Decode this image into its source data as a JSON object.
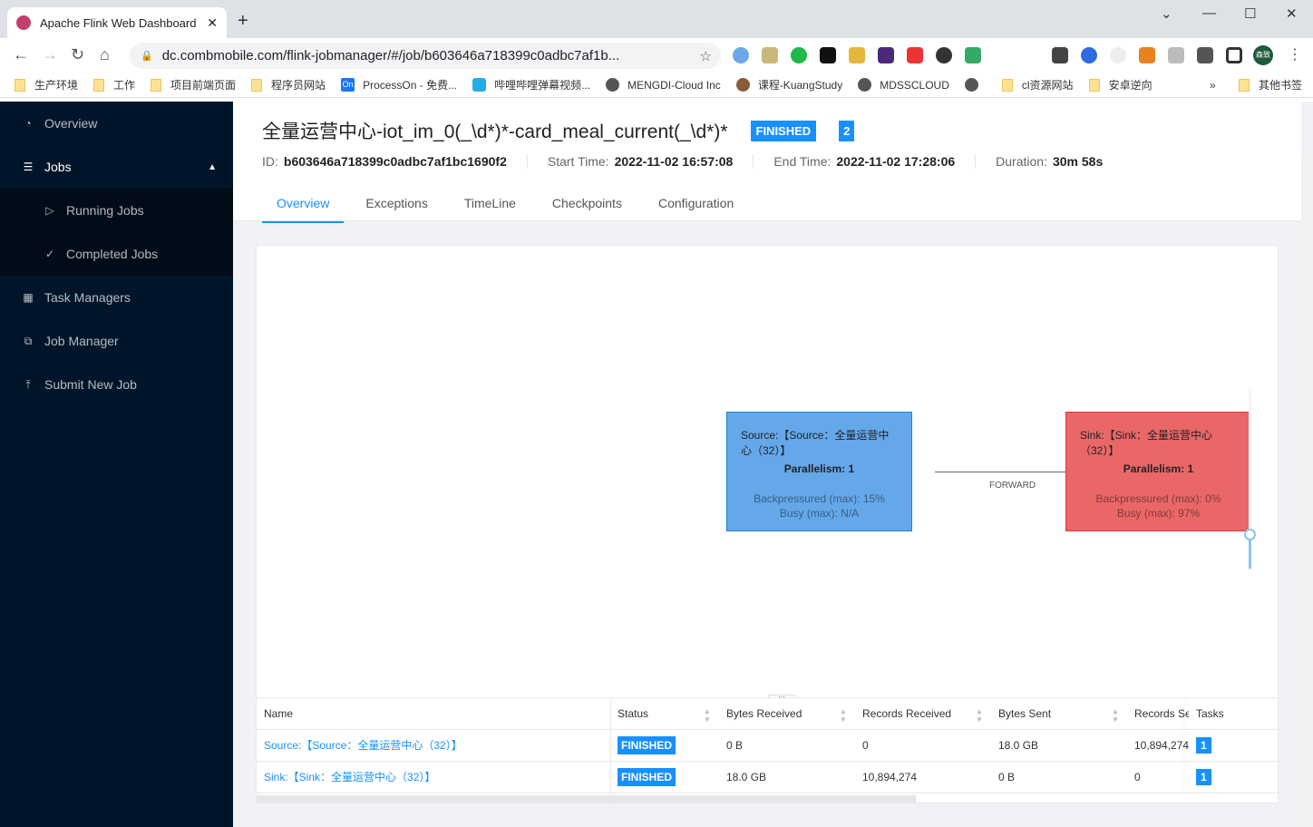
{
  "browser": {
    "tab_title": "Apache Flink Web Dashboard",
    "url": "dc.combmobile.com/flink-jobmanager/#/job/b603646a718399c0adbc7af1b...",
    "bookmarks": [
      "生产环境",
      "工作",
      "项目前端页面",
      "程序员网站",
      "ProcessOn - 免费...",
      "哔哩哔哩弹幕视频...",
      "MENGDI-Cloud Inc",
      "课程-KuangStudy",
      "MDSSCLOUD",
      "",
      "cl资源网站",
      "安卓逆向"
    ],
    "other_bookmarks": "其他书签",
    "profile": "森致"
  },
  "sidebar": {
    "items": [
      {
        "label": "Overview"
      },
      {
        "label": "Jobs"
      },
      {
        "label": "Running Jobs"
      },
      {
        "label": "Completed Jobs"
      },
      {
        "label": "Task Managers"
      },
      {
        "label": "Job Manager"
      },
      {
        "label": "Submit New Job"
      }
    ]
  },
  "job": {
    "name": "全量运营中心-iot_im_0(_\\d*)*-card_meal_current(_\\d*)*",
    "status": "FINISHED",
    "task_count": "2",
    "id_label": "ID:",
    "id": "b603646a718399c0adbc7af1bc1690f2",
    "start_label": "Start Time:",
    "start": "2022-11-02 16:57:08",
    "end_label": "End Time:",
    "end": "2022-11-02 17:28:06",
    "duration_label": "Duration:",
    "duration": "30m 58s"
  },
  "tabs": [
    "Overview",
    "Exceptions",
    "TimeLine",
    "Checkpoints",
    "Configuration"
  ],
  "graph": {
    "nodes": [
      {
        "title": "Source:【Source：全量运营中心（32）】",
        "parallelism": "Parallelism: 1",
        "backpressure": "Backpressured (max): 15%",
        "busy": "Busy (max): N/A",
        "color": "#64a8ea"
      },
      {
        "title": "Sink:【Sink：全量运营中心（32）】",
        "parallelism": "Parallelism: 1",
        "backpressure": "Backpressured (max): 0%",
        "busy": "Busy (max): 97%",
        "color": "#ea6768"
      }
    ],
    "edge_label": "FORWARD"
  },
  "table": {
    "headers": [
      "Name",
      "Status",
      "Bytes Received",
      "Records Received",
      "Bytes Sent",
      "Records Se",
      "Tasks"
    ],
    "rows": [
      {
        "name": "Source:【Source：全量运营中心（32）】",
        "status": "FINISHED",
        "bytes_received": "0 B",
        "records_received": "0",
        "bytes_sent": "18.0 GB",
        "records_sent": "10,894,274",
        "tasks": "1"
      },
      {
        "name": "Sink:【Sink：全量运营中心（32）】",
        "status": "FINISHED",
        "bytes_received": "18.0 GB",
        "records_received": "10,894,274",
        "bytes_sent": "0 B",
        "records_sent": "0",
        "tasks": "1"
      }
    ]
  }
}
